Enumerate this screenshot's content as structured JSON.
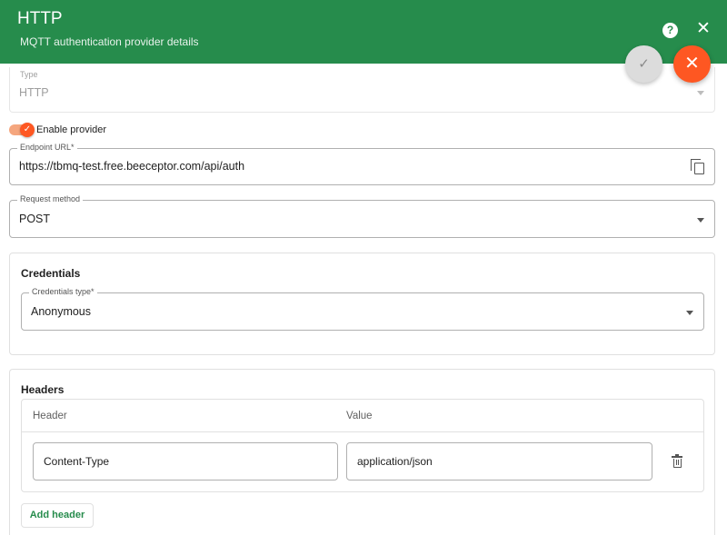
{
  "header": {
    "title": "HTTP",
    "subtitle": "MQTT authentication provider details",
    "help_icon": "help-circle-icon",
    "close_icon": "close-icon",
    "color": "#268c4c"
  },
  "fabs": {
    "save_icon": "check-icon",
    "cancel_icon": "close-icon",
    "cancel_color": "#fe5722"
  },
  "type_field": {
    "label": "Type",
    "value": "HTTP"
  },
  "enable_provider": {
    "label": "Enable provider",
    "checked": true
  },
  "endpoint": {
    "label": "Endpoint URL*",
    "value": "https://tbmq-test.free.beeceptor.com/api/auth",
    "copy_icon": "copy-icon"
  },
  "request_method": {
    "label": "Request method",
    "value": "POST"
  },
  "credentials": {
    "title": "Credentials",
    "type_label": "Credentials type*",
    "type_value": "Anonymous"
  },
  "headers": {
    "title": "Headers",
    "columns": [
      "Header",
      "Value"
    ],
    "rows": [
      {
        "header": "Content-Type",
        "value": "application/json"
      }
    ],
    "delete_icon": "trash-icon",
    "add_label": "Add header"
  }
}
